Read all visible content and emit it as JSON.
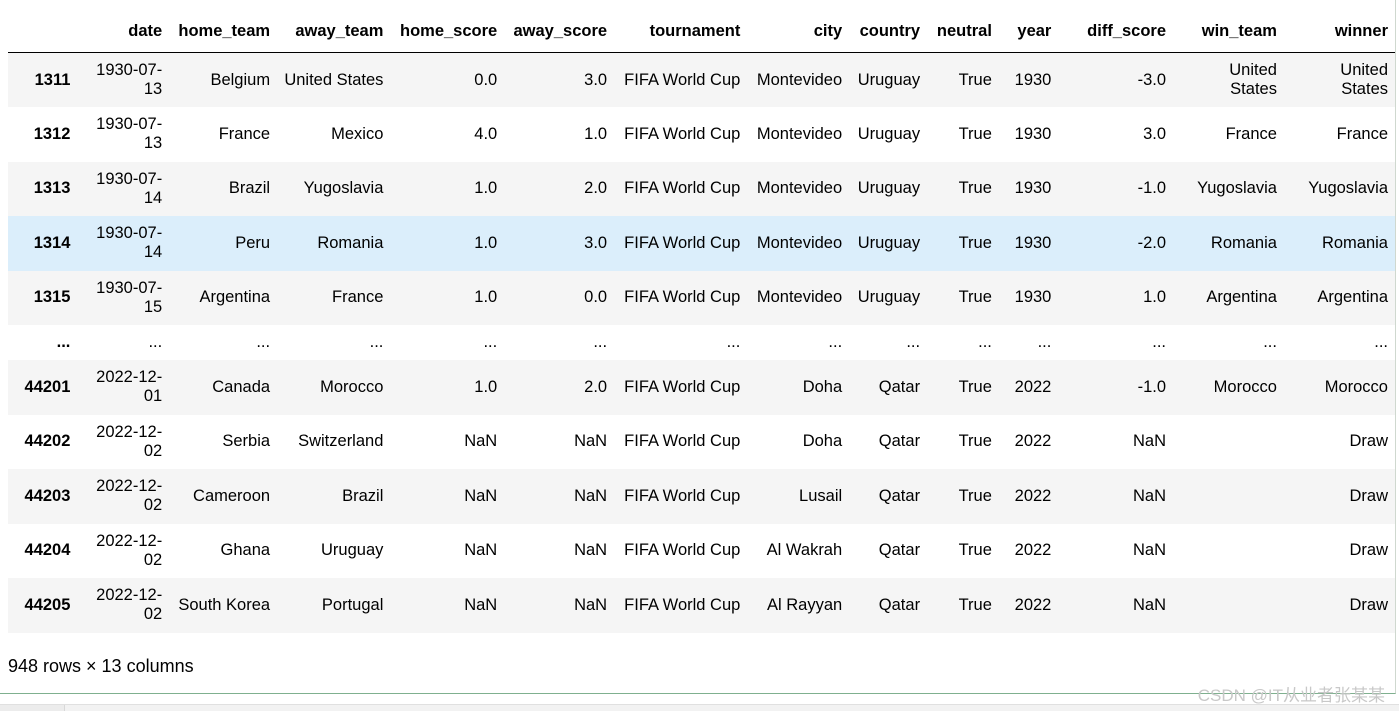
{
  "table": {
    "columns": [
      "date",
      "home_team",
      "away_team",
      "home_score",
      "away_score",
      "tournament",
      "city",
      "country",
      "neutral",
      "year",
      "diff_score",
      "win_team",
      "winner"
    ],
    "rows": [
      {
        "index": "1311",
        "cells": [
          "1930-07-13",
          "Belgium",
          "United States",
          "0.0",
          "3.0",
          "FIFA World Cup",
          "Montevideo",
          "Uruguay",
          "True",
          "1930",
          "-3.0",
          "United States",
          "United States"
        ]
      },
      {
        "index": "1312",
        "cells": [
          "1930-07-13",
          "France",
          "Mexico",
          "4.0",
          "1.0",
          "FIFA World Cup",
          "Montevideo",
          "Uruguay",
          "True",
          "1930",
          "3.0",
          "France",
          "France"
        ]
      },
      {
        "index": "1313",
        "cells": [
          "1930-07-14",
          "Brazil",
          "Yugoslavia",
          "1.0",
          "2.0",
          "FIFA World Cup",
          "Montevideo",
          "Uruguay",
          "True",
          "1930",
          "-1.0",
          "Yugoslavia",
          "Yugoslavia"
        ]
      },
      {
        "index": "1314",
        "cells": [
          "1930-07-14",
          "Peru",
          "Romania",
          "1.0",
          "3.0",
          "FIFA World Cup",
          "Montevideo",
          "Uruguay",
          "True",
          "1930",
          "-2.0",
          "Romania",
          "Romania"
        ],
        "highlight": true
      },
      {
        "index": "1315",
        "cells": [
          "1930-07-15",
          "Argentina",
          "France",
          "1.0",
          "0.0",
          "FIFA World Cup",
          "Montevideo",
          "Uruguay",
          "True",
          "1930",
          "1.0",
          "Argentina",
          "Argentina"
        ]
      },
      {
        "index": "...",
        "cells": [
          "...",
          "...",
          "...",
          "...",
          "...",
          "...",
          "...",
          "...",
          "...",
          "...",
          "...",
          "...",
          "..."
        ],
        "ellipsis": true
      },
      {
        "index": "44201",
        "cells": [
          "2022-12-01",
          "Canada",
          "Morocco",
          "1.0",
          "2.0",
          "FIFA World Cup",
          "Doha",
          "Qatar",
          "True",
          "2022",
          "-1.0",
          "Morocco",
          "Morocco"
        ]
      },
      {
        "index": "44202",
        "cells": [
          "2022-12-02",
          "Serbia",
          "Switzerland",
          "NaN",
          "NaN",
          "FIFA World Cup",
          "Doha",
          "Qatar",
          "True",
          "2022",
          "NaN",
          "",
          "Draw"
        ]
      },
      {
        "index": "44203",
        "cells": [
          "2022-12-02",
          "Cameroon",
          "Brazil",
          "NaN",
          "NaN",
          "FIFA World Cup",
          "Lusail",
          "Qatar",
          "True",
          "2022",
          "NaN",
          "",
          "Draw"
        ]
      },
      {
        "index": "44204",
        "cells": [
          "2022-12-02",
          "Ghana",
          "Uruguay",
          "NaN",
          "NaN",
          "FIFA World Cup",
          "Al Wakrah",
          "Qatar",
          "True",
          "2022",
          "NaN",
          "",
          "Draw"
        ]
      },
      {
        "index": "44205",
        "cells": [
          "2022-12-02",
          "South Korea",
          "Portugal",
          "NaN",
          "NaN",
          "FIFA World Cup",
          "Al Rayyan",
          "Qatar",
          "True",
          "2022",
          "NaN",
          "",
          "Draw"
        ]
      }
    ]
  },
  "footer": {
    "shape_text": "948 rows × 13 columns"
  },
  "watermark": {
    "text": "CSDN @IT从业者张某某"
  },
  "colors": {
    "row_odd": "#f5f5f5",
    "row_even": "#ffffff",
    "row_highlight": "#dbeefb"
  }
}
